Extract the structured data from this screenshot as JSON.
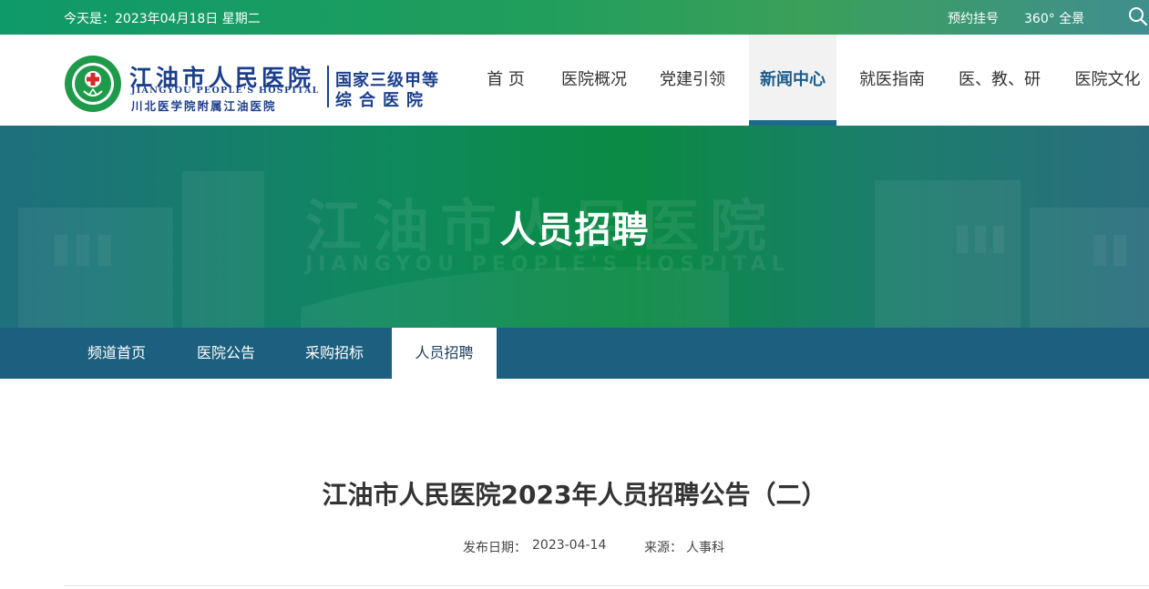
{
  "topbar": {
    "date_text": "今天是：2023年04月18日 星期二",
    "link_appointment": "预约挂号",
    "link_panorama": "360° 全景",
    "search_icon": "search-icon"
  },
  "logo": {
    "name_cn": "江油市人民医院",
    "name_en": "JIANGYOU PEOPLE'S HOSPITAL",
    "affiliation": "川北医学院附属江油医院",
    "grade_line1": "国家三级甲等",
    "grade_line2": "综合医院",
    "colors": {
      "brand_blue": "#1c3f8c",
      "brand_green": "#1e9a4a",
      "brand_red": "#d62b2b"
    }
  },
  "nav": {
    "items": [
      {
        "label": "首  页"
      },
      {
        "label": "医院概况"
      },
      {
        "label": "党建引领"
      },
      {
        "label": "新闻中心",
        "active": true
      },
      {
        "label": "就医指南"
      },
      {
        "label": "医、教、研"
      },
      {
        "label": "医院文化"
      }
    ]
  },
  "banner": {
    "title": "人员招聘",
    "watermark_cn": "江油市人民医院",
    "watermark_en": "JIANGYOU PEOPLE'S HOSPITAL"
  },
  "subnav": {
    "items": [
      {
        "label": "频道首页"
      },
      {
        "label": "医院公告"
      },
      {
        "label": "采购招标"
      },
      {
        "label": "人员招聘",
        "active": true
      }
    ]
  },
  "article": {
    "title": "江油市人民医院2023年人员招聘公告（二）",
    "publish_label": "发布日期：",
    "publish_date": "2023-04-14",
    "source_label": "来源：",
    "source": "人事科"
  }
}
